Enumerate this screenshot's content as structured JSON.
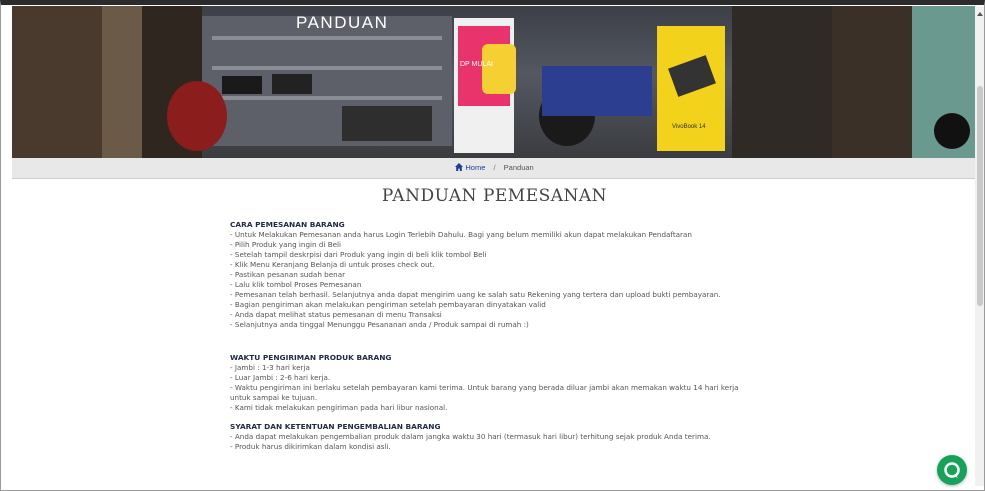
{
  "hero": {
    "title": "PANDUAN",
    "banner_text": [
      "DP MULAI",
      "VivoBook 14"
    ]
  },
  "breadcrumb": {
    "home": "Home",
    "separator": "/",
    "current": "Panduan"
  },
  "page_title": "PANDUAN PEMESANAN",
  "sections": [
    {
      "heading": "CARA PEMESANAN BARANG",
      "lines": [
        "- Untuk Melakukan Pemesanan anda harus Login Terlebih Dahulu. Bagi yang belum memiliki akun dapat melakukan Pendaftaran",
        "- Pilih Produk yang ingin di Beli",
        "- Setelah tampil deskrpisi dari Produk yang ingin di beli klik tombol Beli",
        "- Klik Menu Keranjang Belanja di untuk proses check out.",
        "- Pastikan pesanan sudah benar",
        "- Lalu klik tombol Proses Pemesanan",
        "- Pemesanan telah berhasil. Selanjutnya anda dapat mengirim uang ke salah satu Rekening yang tertera dan upload bukti pembayaran.",
        "- Bagian pengiriman akan melakukan pengiriman setelah pembayaran dinyatakan valid",
        "- Anda dapat melihat status pemesanan di menu Transaksi",
        "- Selanjutnya anda tinggal Menunggu Pesananan anda / Produk sampai di rumah :)"
      ]
    },
    {
      "heading": "WAKTU PENGIRIMAN PRODUK BARANG",
      "lines": [
        "- Jambi : 1-3 hari kerja",
        "- Luar Jambi : 2-6 hari kerja.",
        "- Waktu pengiriman ini berlaku setelah pembayaran kami terima. Untuk barang yang berada diluar jambi akan memakan waktu 14 hari kerja",
        "untuk sampai ke tujuan.",
        "- Kami tidak melakukan pengiriman pada hari libur nasional."
      ]
    },
    {
      "heading": "SYARAT DAN KETENTUAN PENGEMBALIAN BARANG",
      "lines": [
        "- Anda dapat melakukan pengembalian produk dalam jangka waktu 30 hari (termasuk hari libur) terhitung sejak produk Anda terima.",
        "- Produk harus dikirimkan dalam kondisi asli."
      ]
    }
  ],
  "icons": {
    "home": "home-icon",
    "chat": "chat-icon",
    "scroll_up": "scroll-up-icon"
  },
  "colors": {
    "chat": "#15a35a",
    "heading": "#1f2a44",
    "home_link": "#1d3f8f"
  }
}
